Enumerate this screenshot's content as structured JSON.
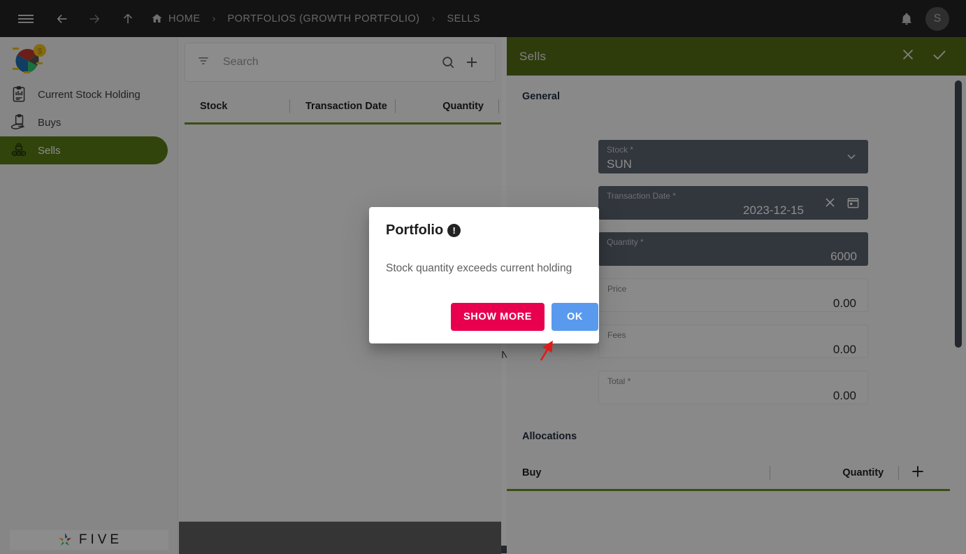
{
  "topbar": {
    "menu_icon": "hamburger-icon",
    "back_icon": "arrow-left-icon",
    "forward_icon": "arrow-right-icon",
    "up_icon": "arrow-up-icon",
    "home_label": "HOME",
    "breadcrumbs": [
      "PORTFOLIOS (GROWTH PORTFOLIO)",
      "SELLS"
    ],
    "separator": "›",
    "notification_icon": "bell-icon",
    "avatar_initial": "S"
  },
  "sidebar": {
    "logo_name": "portfolio-pie-logo",
    "items": [
      {
        "label": "Current Stock Holding",
        "icon": "clipboard-report-icon",
        "active": false
      },
      {
        "label": "Buys",
        "icon": "hand-clipboard-icon",
        "active": false
      },
      {
        "label": "Sells",
        "icon": "money-stack-icon",
        "active": true
      }
    ],
    "brand": "FIVE"
  },
  "list": {
    "search_placeholder": "Search",
    "search_value": "",
    "filter_icon": "filter-icon",
    "search_icon": "search-icon",
    "add_icon": "plus-icon",
    "columns": [
      "Stock",
      "Transaction Date",
      "Quantity"
    ],
    "empty_text": "No Rows"
  },
  "form": {
    "title": "Sells",
    "close_icon": "close-icon",
    "confirm_icon": "check-icon",
    "general_label": "General",
    "fields": [
      {
        "label": "Stock *",
        "value": "SUN",
        "style": "filled",
        "align": "left",
        "error": false,
        "icon": "chevron-down-icon"
      },
      {
        "label": "Transaction Date *",
        "value": "2023-12-15",
        "style": "filled",
        "align": "right",
        "error": false,
        "icons": [
          "close-icon",
          "calendar-icon"
        ]
      },
      {
        "label": "Quantity *",
        "value": "6000",
        "style": "filled",
        "align": "right",
        "error": true
      },
      {
        "label": "Price",
        "value": "0.00",
        "style": "plain",
        "align": "right",
        "error": false
      },
      {
        "label": "Fees",
        "value": "0.00",
        "style": "plain",
        "align": "right",
        "error": false
      },
      {
        "label": "Total *",
        "value": "0.00",
        "style": "plain",
        "align": "right",
        "error": false
      }
    ],
    "allocations_label": "Allocations",
    "alloc_columns": [
      "Buy",
      "Quantity"
    ],
    "alloc_add_icon": "plus-icon"
  },
  "dialog": {
    "title": "Portfolio",
    "badge_icon": "exclamation-icon",
    "badge_glyph": "!",
    "message": "Stock quantity exceeds current holding",
    "show_more_label": "SHOW MORE",
    "ok_label": "OK"
  },
  "annotation": {
    "name": "red-arrow-pointer"
  },
  "colors": {
    "accent_green": "#5a7c15",
    "header_green": "#546e17",
    "underline_green": "#6b8e23",
    "topbar_dark": "#232323",
    "field_filled": "#5c6370",
    "error_red": "#d93025",
    "show_more_pink": "#e8004f",
    "ok_blue": "#1a73e8",
    "annotation_red": "#e01b1b"
  }
}
